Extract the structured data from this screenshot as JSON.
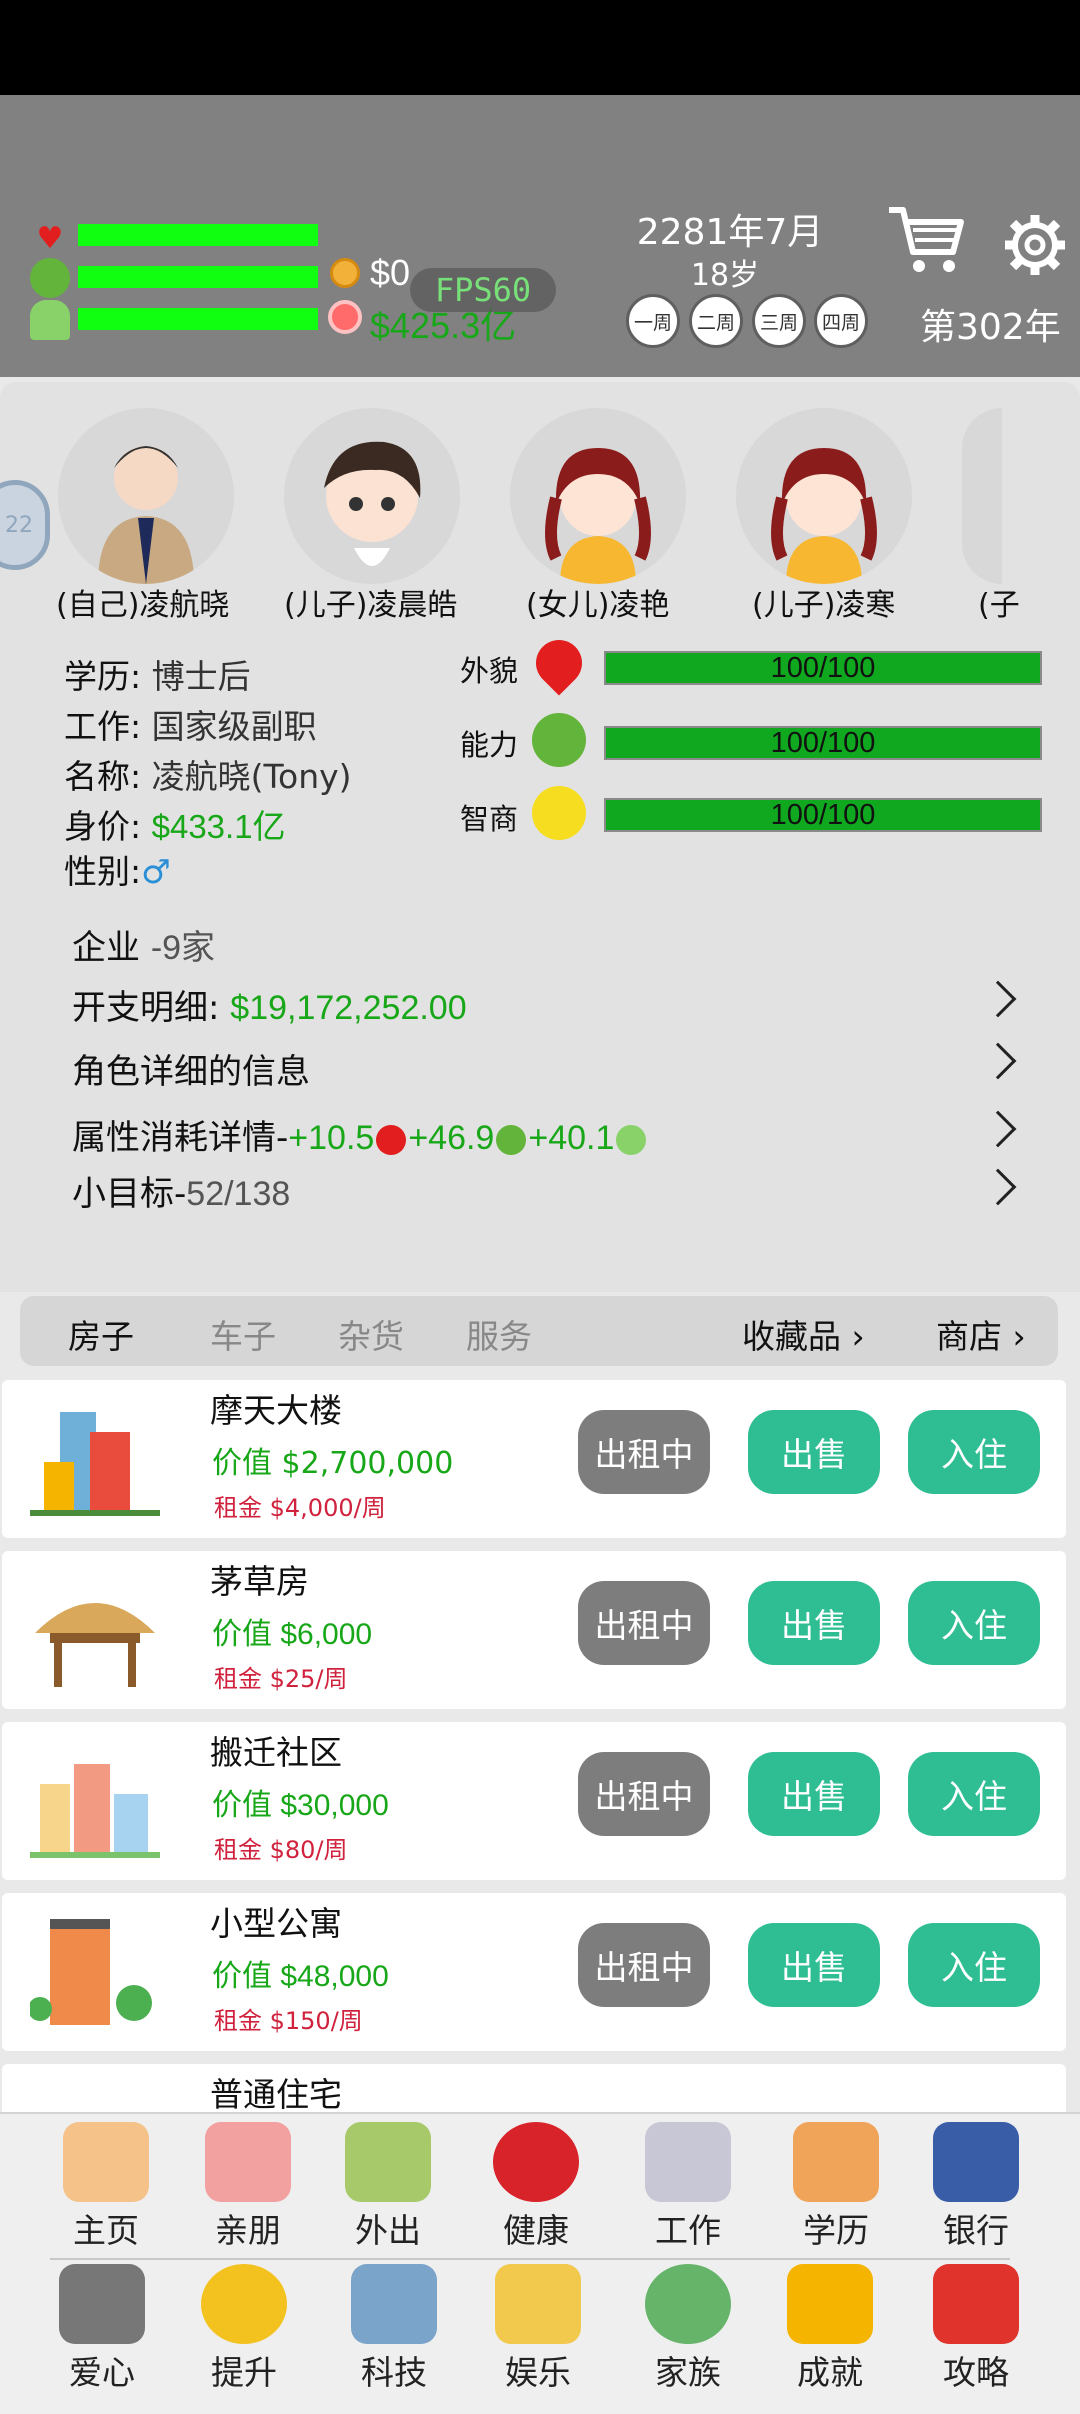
{
  "header": {
    "money": "$0",
    "assets": "$425.3亿",
    "fps": "FPS60",
    "date": "2281年7月",
    "age": "18岁",
    "weeks": [
      "一周",
      "二周",
      "三周",
      "四周"
    ],
    "year": "第302年"
  },
  "family": [
    {
      "name": "(自己)凌航晓"
    },
    {
      "name": "(儿子)凌晨皓"
    },
    {
      "name": "(女儿)凌艳"
    },
    {
      "name": "(儿子)凌寒"
    },
    {
      "name": "(子"
    }
  ],
  "side_badge": "22",
  "profile": {
    "education_label": "学历:",
    "education": "博士后",
    "job_label": "工作:",
    "job": "国家级副职",
    "name_label": "名称:",
    "name": "凌航晓(Tony)",
    "worth_label": "身价:",
    "worth": "$433.1亿",
    "gender_label": "性别:",
    "gender": "♂"
  },
  "stats": [
    {
      "label": "外貌",
      "value": "100/100",
      "fraction": 1.0
    },
    {
      "label": "能力",
      "value": "100/100",
      "fraction": 1.0
    },
    {
      "label": "智商",
      "value": "100/100",
      "fraction": 1.0
    }
  ],
  "details": {
    "companies_label": "企业",
    "companies": "-9家",
    "expense_label": "开支明细:",
    "expense": "$19,172,252.00",
    "role_info": "角色详细的信息",
    "attr_label": "属性消耗详情-",
    "attr_a": "+10.5",
    "attr_b": "+46.9",
    "attr_c": "+40.1",
    "goal_label": "小目标-",
    "goal": "52/138"
  },
  "tabs": {
    "house": "房子",
    "car": "车子",
    "goods": "杂货",
    "service": "服务",
    "collection": "收藏品",
    "shop": "商店"
  },
  "properties": [
    {
      "title": "摩天大楼",
      "price": "价值 $2,700,000",
      "rent": "租金 $4,000/周"
    },
    {
      "title": "茅草房",
      "price": "价值 $6,000",
      "rent": "租金 $25/周"
    },
    {
      "title": "搬迁社区",
      "price": "价值 $30,000",
      "rent": "租金 $80/周"
    },
    {
      "title": "小型公寓",
      "price": "价值 $48,000",
      "rent": "租金 $150/周"
    },
    {
      "title": "普通住宅"
    }
  ],
  "buttons": {
    "renting": "出租中",
    "sell": "出售",
    "move_in": "入住"
  },
  "dock": {
    "row1": [
      "主页",
      "亲朋",
      "外出",
      "健康",
      "工作",
      "学历",
      "银行"
    ],
    "row2": [
      "爱心",
      "提升",
      "科技",
      "娱乐",
      "家族",
      "成就",
      "攻略"
    ]
  },
  "colors": {
    "header_bg": "#818181",
    "bar_green": "#10ff10",
    "stat_green": "#0fa81f",
    "button_green": "#2fbe93",
    "button_grey": "#7d7d7d",
    "money_green": "#18a718",
    "rent_red": "#d0213d"
  }
}
